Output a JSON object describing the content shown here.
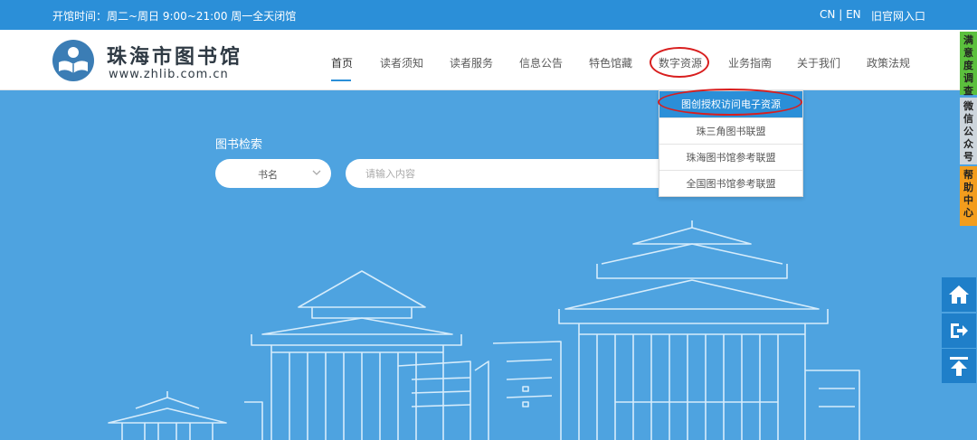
{
  "topbar": {
    "hours": "开馆时间：周二~周日 9:00~21:00 周一全天闭馆",
    "lang_cn": "CN",
    "lang_sep": "|",
    "lang_en": "EN",
    "old_site": "旧官网入口"
  },
  "logo": {
    "name": "珠海市图书馆",
    "url": "www.zhlib.com.cn"
  },
  "nav": {
    "items": [
      "首页",
      "读者须知",
      "读者服务",
      "信息公告",
      "特色馆藏",
      "数字资源",
      "业务指南",
      "关于我们",
      "政策法规"
    ],
    "active_index": 0
  },
  "dropdown": {
    "items": [
      "图创授权访问电子资源",
      "珠三角图书联盟",
      "珠海图书馆参考联盟",
      "全国图书馆参考联盟"
    ]
  },
  "side_tabs": {
    "satisfaction": "满意度调查",
    "wechat": "微信公众号",
    "help": "帮助中心"
  },
  "search": {
    "title": "图书检索",
    "select_value": "书名",
    "placeholder": "请输入内容"
  },
  "colors": {
    "brand": "#2b8fd8",
    "background": "#4ea3e0",
    "highlight": "#d81e1e"
  }
}
